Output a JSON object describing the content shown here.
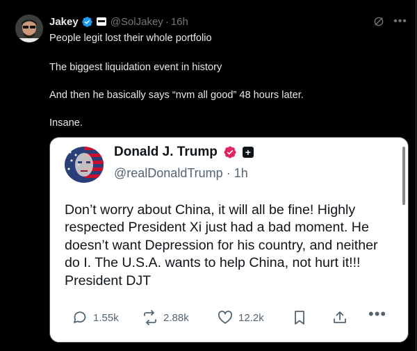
{
  "tweet": {
    "author_name": "Jakey",
    "handle": "@SolJakey",
    "separator": "·",
    "time": "16h",
    "lines": [
      "People legit lost their whole portfolio",
      "The biggest liquidation event in history",
      "And then he basically says “nvm all good” 48 hours later.",
      "Insane."
    ],
    "icons": {
      "grok": "grok-icon",
      "more": "more-icon"
    },
    "colors": {
      "verified": "#1d9bf0",
      "background": "#000000",
      "text": "#e7e9ea",
      "muted": "#71767b"
    }
  },
  "quoted": {
    "author_name": "Donald J. Trump",
    "handle": "@realDonaldTrump",
    "separator": "·",
    "time": "1h",
    "body": "Don’t worry about China, it will all be fine! Highly respected President Xi just had a bad moment. He doesn’t want Depression for his country, and neither do I. The U.S.A. wants to help China, not hurt it!!!  President DJT",
    "actions": {
      "replies": "1.55k",
      "reposts": "2.88k",
      "likes": "12.2k"
    },
    "colors": {
      "verified_badge": "#e0245e",
      "background": "#ffffff",
      "text": "#0f1419"
    }
  }
}
